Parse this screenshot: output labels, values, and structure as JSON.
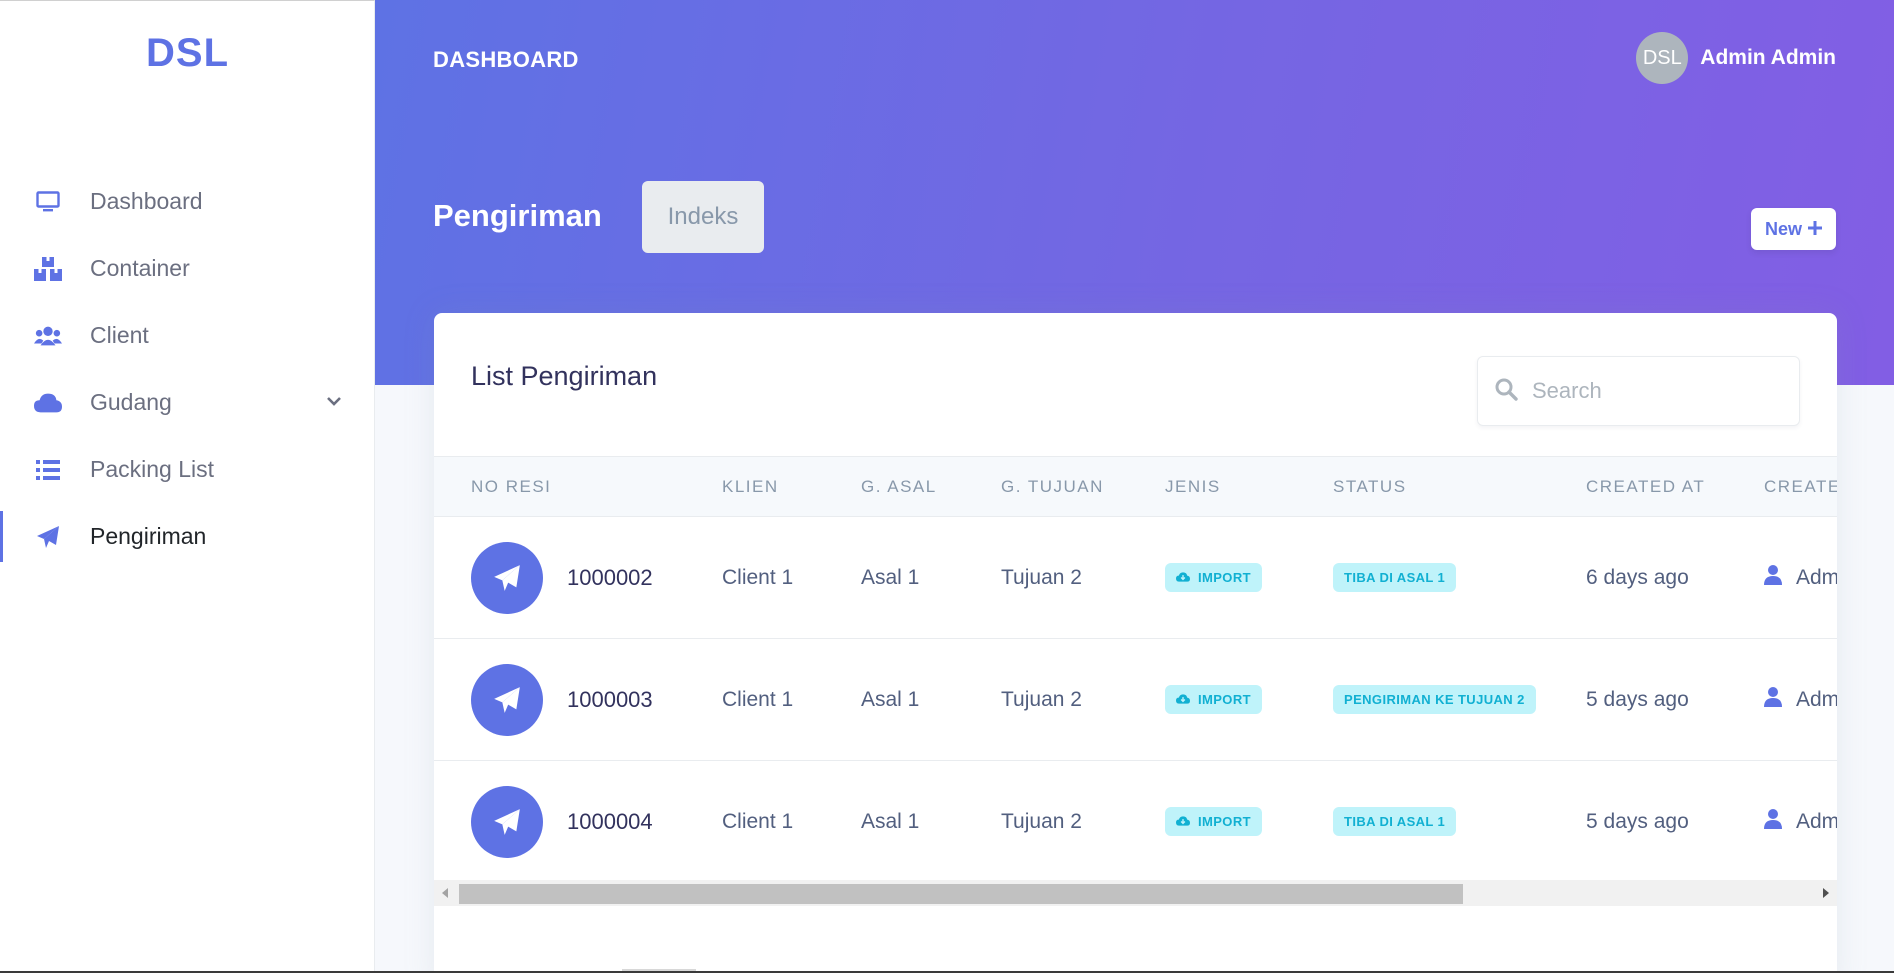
{
  "sidebar": {
    "brand": "DSL",
    "items": [
      {
        "label": "Dashboard",
        "icon": "monitor-icon"
      },
      {
        "label": "Container",
        "icon": "boxes-icon"
      },
      {
        "label": "Client",
        "icon": "users-icon"
      },
      {
        "label": "Gudang",
        "icon": "cloud-icon"
      },
      {
        "label": "Packing List",
        "icon": "list-icon"
      },
      {
        "label": "Pengiriman",
        "icon": "paper-plane-icon"
      }
    ],
    "active_item": "Pengiriman"
  },
  "header": {
    "title": "DASHBOARD",
    "user": {
      "avatar_text": "DSL",
      "name": "Admin Admin"
    },
    "page_title": "Pengiriman",
    "breadcrumb": "Indeks",
    "new_button": "New"
  },
  "card": {
    "title": "List Pengiriman",
    "search_placeholder": "Search",
    "columns": [
      "NO RESI",
      "KLIEN",
      "G. ASAL",
      "G. TUJUAN",
      "JENIS",
      "STATUS",
      "CREATED AT",
      "CREATED BY"
    ],
    "rows": [
      {
        "no_resi": "1000002",
        "klien": "Client 1",
        "asal": "Asal 1",
        "tujuan": "Tujuan 2",
        "jenis": "IMPORT",
        "status": "TIBA DI ASAL 1",
        "created_at": "6 days ago",
        "created_by": "Admin"
      },
      {
        "no_resi": "1000003",
        "klien": "Client 1",
        "asal": "Asal 1",
        "tujuan": "Tujuan 2",
        "jenis": "IMPORT",
        "status": "PENGIRIMAN KE TUJUAN 2",
        "created_at": "5 days ago",
        "created_by": "Admin"
      },
      {
        "no_resi": "1000004",
        "klien": "Client 1",
        "asal": "Asal 1",
        "tujuan": "Tujuan 2",
        "jenis": "IMPORT",
        "status": "TIBA DI ASAL 1",
        "created_at": "5 days ago",
        "created_by": "Admin"
      }
    ]
  },
  "colors": {
    "primary": "#5e72e4",
    "gradient_end": "#825ee4",
    "badge_bg": "#bff3fa",
    "badge_text": "#11b0d2"
  }
}
